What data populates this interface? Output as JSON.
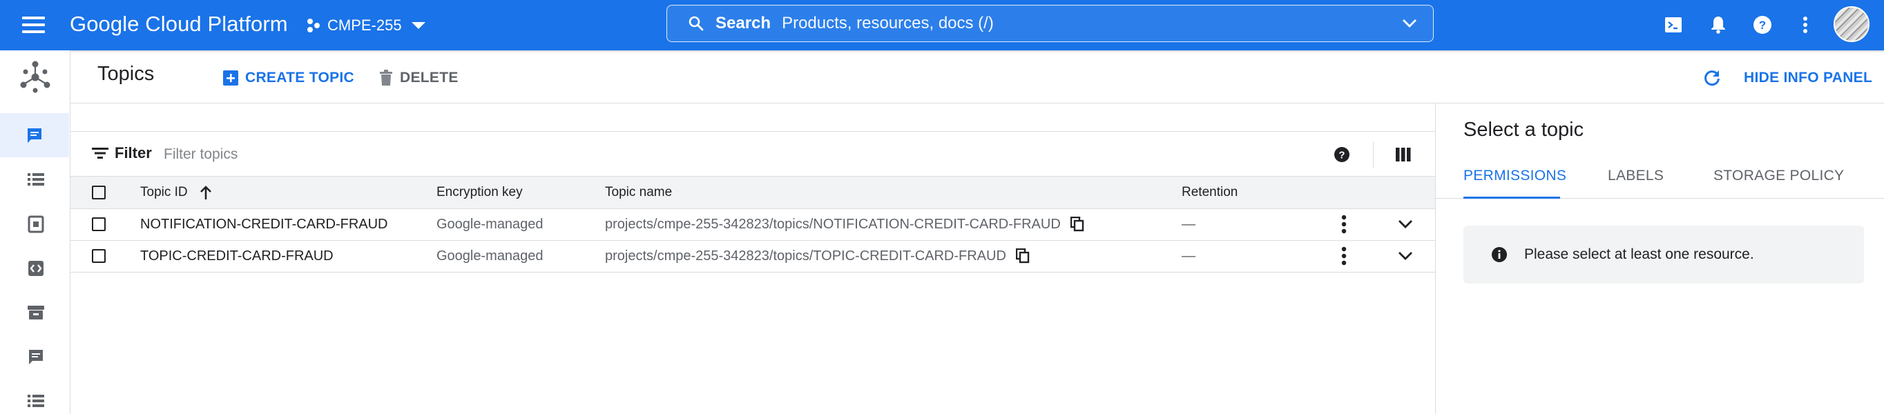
{
  "header": {
    "brand": "Google Cloud Platform",
    "project": "CMPE-255",
    "search_label": "Search",
    "search_placeholder": "Products, resources, docs (/)",
    "accent": "#1a73e8"
  },
  "rail": {
    "items": [
      "pubsub-topics-icon",
      "list-icon",
      "snapshot-icon",
      "code-icon",
      "archive-icon",
      "chat-icon",
      "list-icon"
    ]
  },
  "page": {
    "title": "Topics",
    "create_label": "CREATE TOPIC",
    "delete_label": "DELETE",
    "hide_panel_label": "HIDE INFO PANEL"
  },
  "filter": {
    "label": "Filter",
    "placeholder": "Filter topics"
  },
  "table": {
    "columns": {
      "topic_id": "Topic ID",
      "encryption": "Encryption key",
      "topic_name": "Topic name",
      "retention": "Retention"
    },
    "rows": [
      {
        "topic_id": "NOTIFICATION-CREDIT-CARD-FRAUD",
        "encryption": "Google-managed",
        "topic_name": "projects/cmpe-255-342823/topics/NOTIFICATION-CREDIT-CARD-FRAUD",
        "retention": "—"
      },
      {
        "topic_id": "TOPIC-CREDIT-CARD-FRAUD",
        "encryption": "Google-managed",
        "topic_name": "projects/cmpe-255-342823/topics/TOPIC-CREDIT-CARD-FRAUD",
        "retention": "—"
      }
    ]
  },
  "info_panel": {
    "title": "Select a topic",
    "tabs": [
      "PERMISSIONS",
      "LABELS",
      "STORAGE POLICY"
    ],
    "active_tab": "PERMISSIONS",
    "notice": "Please select at least one resource."
  }
}
